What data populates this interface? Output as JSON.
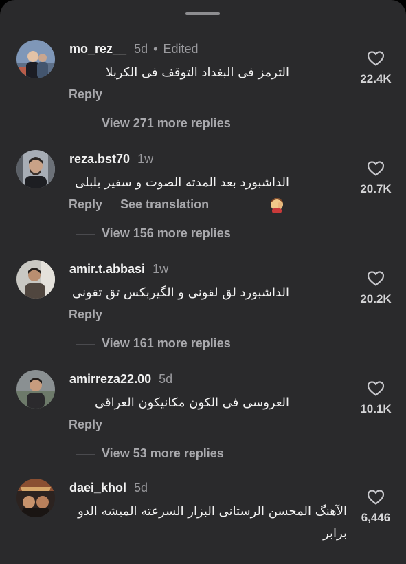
{
  "comments": [
    {
      "username": "mo_rez__",
      "time": "5d",
      "edited": "Edited",
      "text": "الترمز فی البغداد التوقف فی الکربلا",
      "reply_label": "Reply",
      "likes": "22.4K",
      "view_replies": "View 271 more replies"
    },
    {
      "username": "reza.bst70",
      "time": "1w",
      "text": "الداشبورد بعد المدته الصوت و سفیر بلبلی",
      "emoji": "facepalm-emoji",
      "reply_label": "Reply",
      "see_translation": "See translation",
      "likes": "20.7K",
      "view_replies": "View 156 more replies"
    },
    {
      "username": "amir.t.abbasi",
      "time": "1w",
      "text": "الداشبورد لق لقونی و الگیربکس تق تقونی",
      "reply_label": "Reply",
      "likes": "20.2K",
      "view_replies": "View 161 more replies"
    },
    {
      "username": "amirreza22.00",
      "time": "5d",
      "text": "العروسی فی الکون مکانیکون العراقی",
      "reply_label": "Reply",
      "likes": "10.1K",
      "view_replies": "View 53 more replies"
    },
    {
      "username": "daei_khol",
      "time": "5d",
      "text": "الآهنگ المحسن الرستانی البزار السرعته المیشه الدو برابر",
      "likes": "6,446"
    }
  ],
  "colors": {
    "sheet_bg": "#2a2a2c",
    "primary_text": "#f2f2f2",
    "secondary_text": "#9a9a9e"
  }
}
